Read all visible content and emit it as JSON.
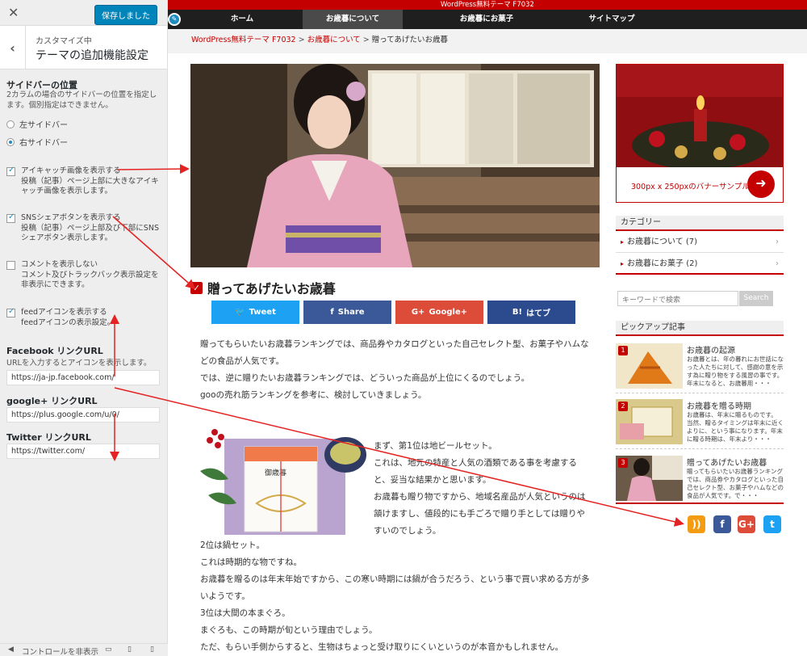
{
  "customizer": {
    "save_label": "保存しました",
    "sub_label": "カスタマイズ中",
    "title": "テーマの追加機能設定",
    "sidebar_position": {
      "title": "サイドバーの位置",
      "desc": "2カラムの場合のサイドバーの位置を指定します。個別指定はできません。",
      "options": [
        "左サイドバー",
        "右サイドバー"
      ],
      "selected": "右サイドバー"
    },
    "checks": [
      {
        "label": "アイキャッチ画像を表示する",
        "desc": "投稿（記事）ページ上部に大きなアイキャッチ画像を表示します。",
        "checked": true
      },
      {
        "label": "SNSシェアボタンを表示する",
        "desc": "投稿（記事）ページ上部及び下部にSNSシェアボタン表示します。",
        "checked": true
      },
      {
        "label": "コメントを表示しない",
        "desc": "コメント及びトラックバック表示設定を非表示にできます。",
        "checked": false
      },
      {
        "label": "feedアイコンを表示する",
        "desc": "feedアイコンの表示設定。",
        "checked": true
      }
    ],
    "facebook": {
      "title": "Facebook リンクURL",
      "desc": "URLを入力するとアイコンを表示します。",
      "value": "https://ja-jp.facebook.com/"
    },
    "google": {
      "title": "google+ リンクURL",
      "value": "https://plus.google.com/u/0/"
    },
    "twitter": {
      "title": "Twitter リンクURL",
      "value": "https://twitter.com/"
    },
    "hide_controls": "コントロールを非表示"
  },
  "preview": {
    "topbar": "WordPress無料テーマ F7032",
    "nav": [
      "ホーム",
      "お歳暮について",
      "お歳暮にお菓子",
      "サイトマップ"
    ],
    "nav_active": "お歳暮について",
    "breadcrumb": {
      "home": "WordPress無料テーマ F7032",
      "cat": "お歳暮について",
      "current": "贈ってあげたいお歳暮",
      "sep": ">"
    },
    "post_title": "贈ってあげたいお歳暮",
    "share": [
      {
        "label": "Tweet",
        "icon": "twitter-bird",
        "color": "#1da1f2"
      },
      {
        "label": "Share",
        "icon": "facebook-f",
        "color": "#3b5998"
      },
      {
        "label": "Google+",
        "icon": "google-plus",
        "color": "#dd4b39"
      },
      {
        "label": "はてブ",
        "icon": "hatena-b",
        "color": "#2c4a8e"
      }
    ],
    "share_glyphs": [
      "🐦",
      "f",
      "G+",
      "B!"
    ],
    "body_paragraphs": [
      "贈ってもらいたいお歳暮ランキングでは、商品券やカタログといった自己セレクト型、お菓子やハムなどの食品が人気です。",
      "では、逆に贈りたいお歳暮ランキングでは、どういった商品が上位にくるのでしょう。",
      "gooの売れ筋ランキングを参考に、検討していきましょう。"
    ],
    "float_paragraphs": [
      "まず、第1位は地ビールセット。",
      "これは、地元の特産と人気の酒類である事を考慮すると、妥当な結果かと思います。",
      "お歳暮も贈り物ですから、地域名産品が人気というのは頷けますし、値段的にも手ごろで贈り手としては贈りやすいのでしょう。"
    ],
    "after_paragraphs": [
      "2位は鍋セット。",
      "これは時期的な物ですね。",
      "お歳暮を贈るのは年末年始ですから、この寒い時期には鍋が合うだろう、という事で買い求める方が多いようです。",
      "3位は大間の本まぐろ。",
      "まぐろも、この時期が旬という理由でしょう。",
      "ただ、もらい手側からすると、生物はちょっと受け取りにくいというのが本音かもしれません。"
    ],
    "gift_label": "御歳暮",
    "banner_text": "300px x 250pxのバナーサンプル",
    "category_title": "カテゴリー",
    "categories": [
      "お歳暮について (7)",
      "お歳暮にお菓子 (2)"
    ],
    "search_placeholder": "キーワードで検索",
    "search_button": "Search",
    "pickup_title": "ピックアップ記事",
    "pickups": [
      {
        "num": "1",
        "title": "お歳暮の起源",
        "excerpt": "お歳暮とは、年の暮れにお世話になった人たちに対して、感謝の意を示す為に贈り物をする風習の事です。年末になると、お歳暮用・・・"
      },
      {
        "num": "2",
        "title": "お歳暮を贈る時期",
        "excerpt": "お歳暮は、年末に贈るものです。 当然、贈るタイミングは年末に近くよりに、という事になります。年末に贈る時期は、年末より・・・"
      },
      {
        "num": "3",
        "title": "贈ってあげたいお歳暮",
        "excerpt": "贈ってもらいたいお歳暮ランキングでは、商品券やカタログといった自己セレクト型、お菓子やハムなどの食品が人気です。で・・・"
      }
    ],
    "sns_icons": [
      {
        "icon": "rss-icon",
        "glyph": "))",
        "color": "#f39c12"
      },
      {
        "icon": "facebook-icon",
        "glyph": "f",
        "color": "#3b5998"
      },
      {
        "icon": "google-plus-icon",
        "glyph": "G+",
        "color": "#dd4b39"
      },
      {
        "icon": "twitter-icon",
        "glyph": "t",
        "color": "#1da1f2"
      }
    ]
  }
}
